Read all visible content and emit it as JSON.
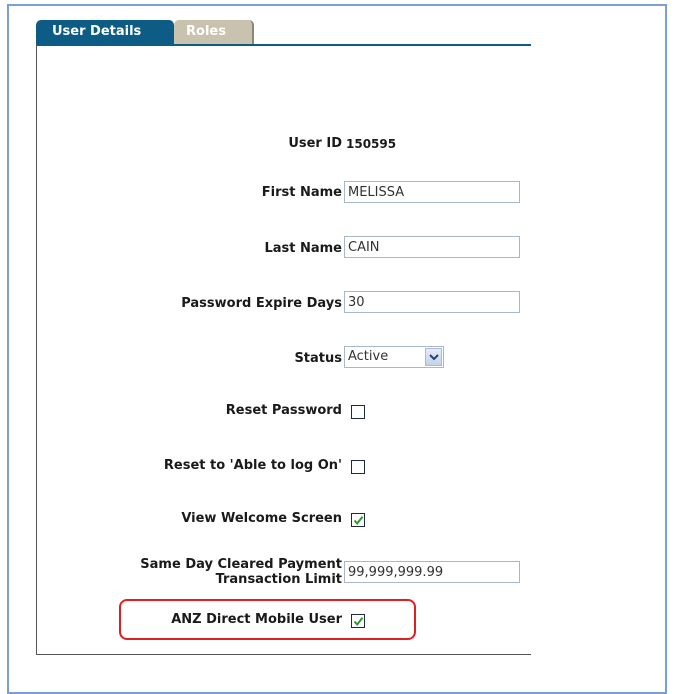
{
  "tabs": {
    "user_details": "User Details",
    "roles": "Roles"
  },
  "form": {
    "user_id": {
      "label": "User ID",
      "value": "150595"
    },
    "first_name": {
      "label": "First Name",
      "value": "MELISSA"
    },
    "last_name": {
      "label": "Last Name",
      "value": "CAIN"
    },
    "password_expire_days": {
      "label": "Password Expire Days",
      "value": "30"
    },
    "status": {
      "label": "Status",
      "value": "Active"
    },
    "reset_password": {
      "label": "Reset Password",
      "checked": false
    },
    "reset_able_to_log_on": {
      "label": "Reset to 'Able to log On'",
      "checked": false
    },
    "view_welcome_screen": {
      "label": "View Welcome Screen",
      "checked": true
    },
    "same_day_limit": {
      "label_line1": "Same Day Cleared Payment",
      "label_line2": "Transaction Limit",
      "value": "99,999,999.99"
    },
    "anz_direct_mobile_user": {
      "label": "ANZ Direct Mobile User",
      "checked": true
    }
  },
  "colors": {
    "tab_active": "#0d5c86",
    "tab_inactive": "#c9c2ae",
    "frame": "#7a9fd4",
    "highlight": "#e02020",
    "check": "#2a9a2a"
  },
  "icons": {
    "dropdown": "chevron-down-icon",
    "checkmark": "checkmark-icon"
  }
}
